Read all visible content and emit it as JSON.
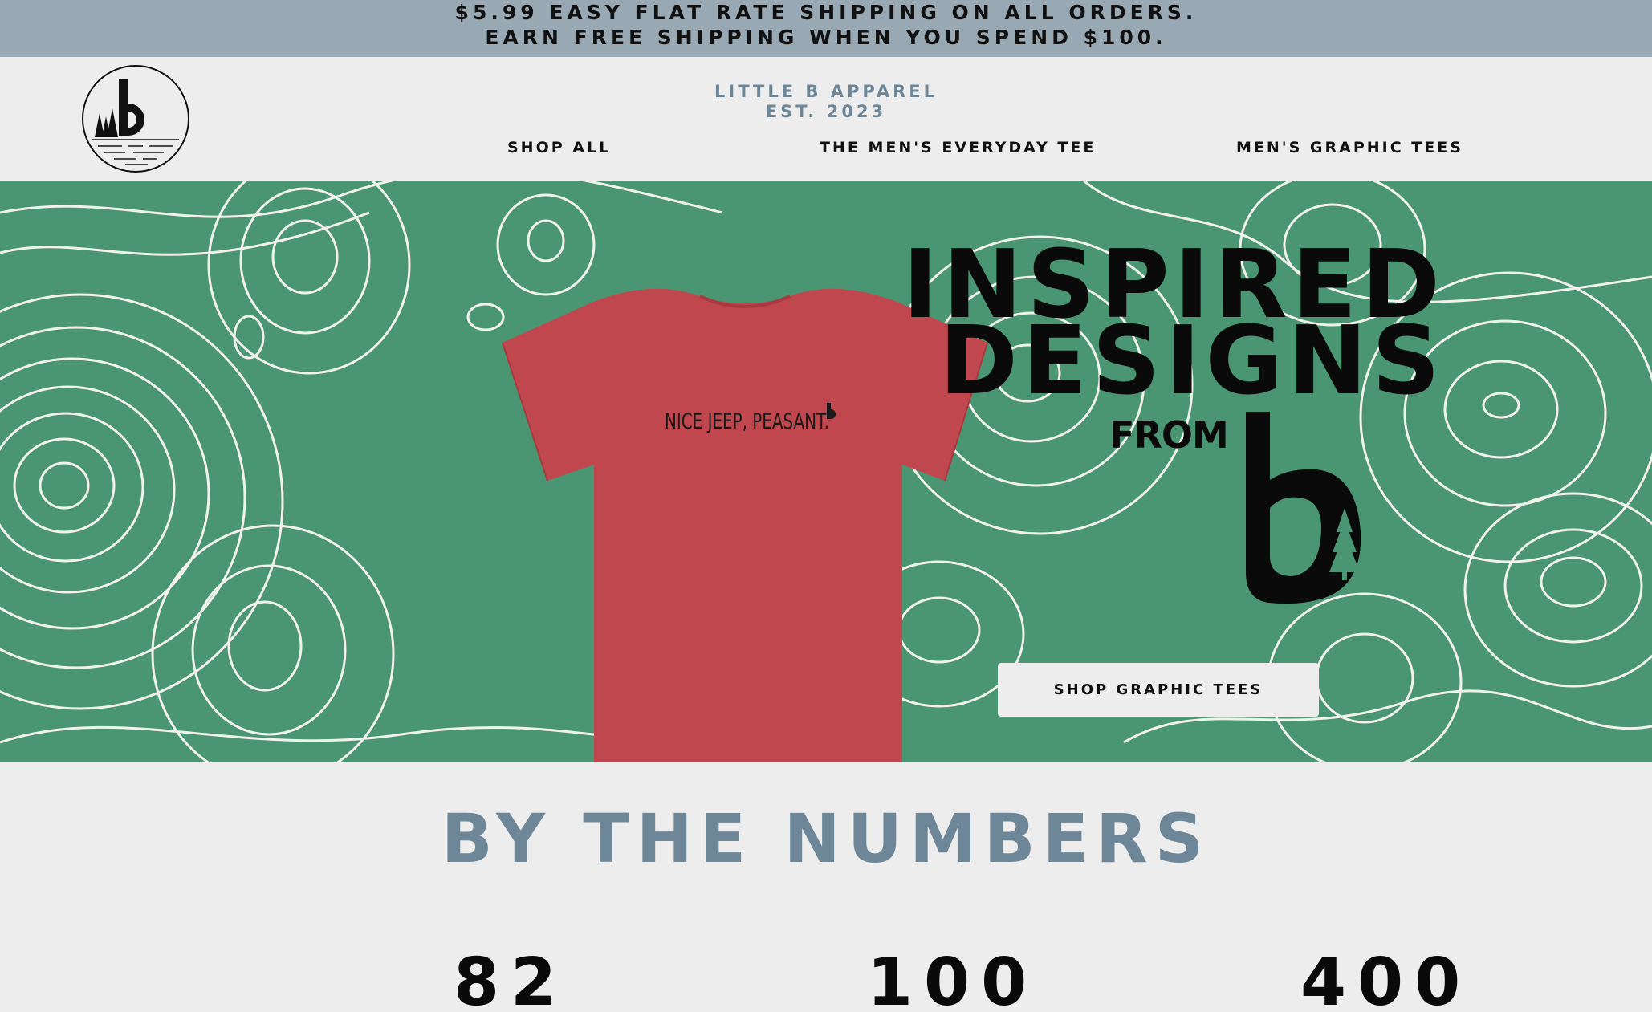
{
  "announcement": {
    "line1": "$5.99 EASY FLAT RATE SHIPPING ON ALL ORDERS.",
    "line2": "EARN FREE SHIPPING WHEN YOU SPEND $100."
  },
  "header": {
    "brand_line1": "LITTLE B APPAREL",
    "brand_line2": "EST. 2023",
    "nav": [
      {
        "label": "SHOP ALL"
      },
      {
        "label": "THE MEN'S EVERYDAY TEE"
      },
      {
        "label": "MEN'S GRAPHIC TEES"
      }
    ]
  },
  "hero": {
    "tee_print": "NICE JEEP, PEASANT.",
    "headline_line1": "INSPIRED",
    "headline_line2": "DESIGNS",
    "from": "FROM",
    "cta_label": "SHOP GRAPHIC TEES",
    "colors": {
      "background": "#4a9672",
      "tee": "#c0474e",
      "contour": "#f2f2ea"
    }
  },
  "numbers": {
    "title": "BY THE NUMBERS",
    "stats": [
      "82",
      "100",
      "400"
    ]
  },
  "colors": {
    "announce_bg": "#99a9b3",
    "page_bg": "#ededed",
    "accent_slate": "#6e8798"
  }
}
